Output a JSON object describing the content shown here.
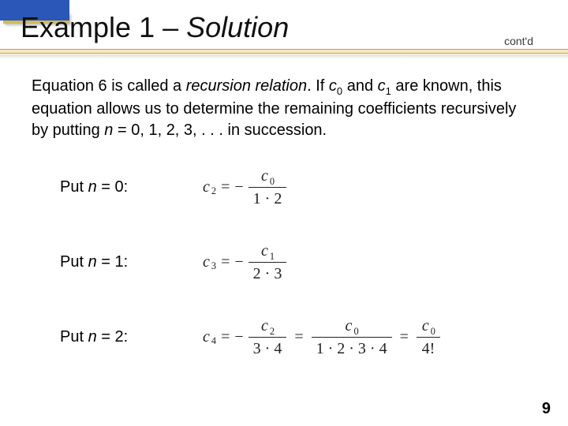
{
  "header": {
    "title_plain": "Example 1 ",
    "title_dash": "– ",
    "title_ital": "Solution",
    "contd": "cont'd"
  },
  "paragraph": {
    "p1": "Equation 6 is called a ",
    "p2_ital": "recursion relation",
    "p3": ". If ",
    "c": "c",
    "sub0": "0",
    "p4": " and ",
    "sub1": "1",
    "p5": " are known, this equation allows us to determine the remaining coefficients recursively by putting ",
    "n": "n",
    "p6": " = 0, 1, 2, 3, . . . in succession."
  },
  "rows": [
    {
      "label_pre": "Put ",
      "label_var": "n",
      "label_post": " = 0:",
      "lhs_sub": "2",
      "rhs_num_sub": "0",
      "rhs_den": "1 · 2",
      "extra": null
    },
    {
      "label_pre": "Put ",
      "label_var": "n",
      "label_post": " = 1:",
      "lhs_sub": "3",
      "rhs_num_sub": "1",
      "rhs_den": "2 · 3",
      "extra": null
    },
    {
      "label_pre": "Put ",
      "label_var": "n",
      "label_post": " = 2:",
      "lhs_sub": "4",
      "rhs_num_sub": "2",
      "rhs_den": "3 · 4",
      "extra": {
        "mid_num_sub": "0",
        "mid_den": "1 · 2 · 3 · 4",
        "final_num_sub": "0",
        "final_den": "4!"
      }
    }
  ],
  "page": "9",
  "sym": {
    "c": "c",
    "eq": "=",
    "minus": "−"
  }
}
